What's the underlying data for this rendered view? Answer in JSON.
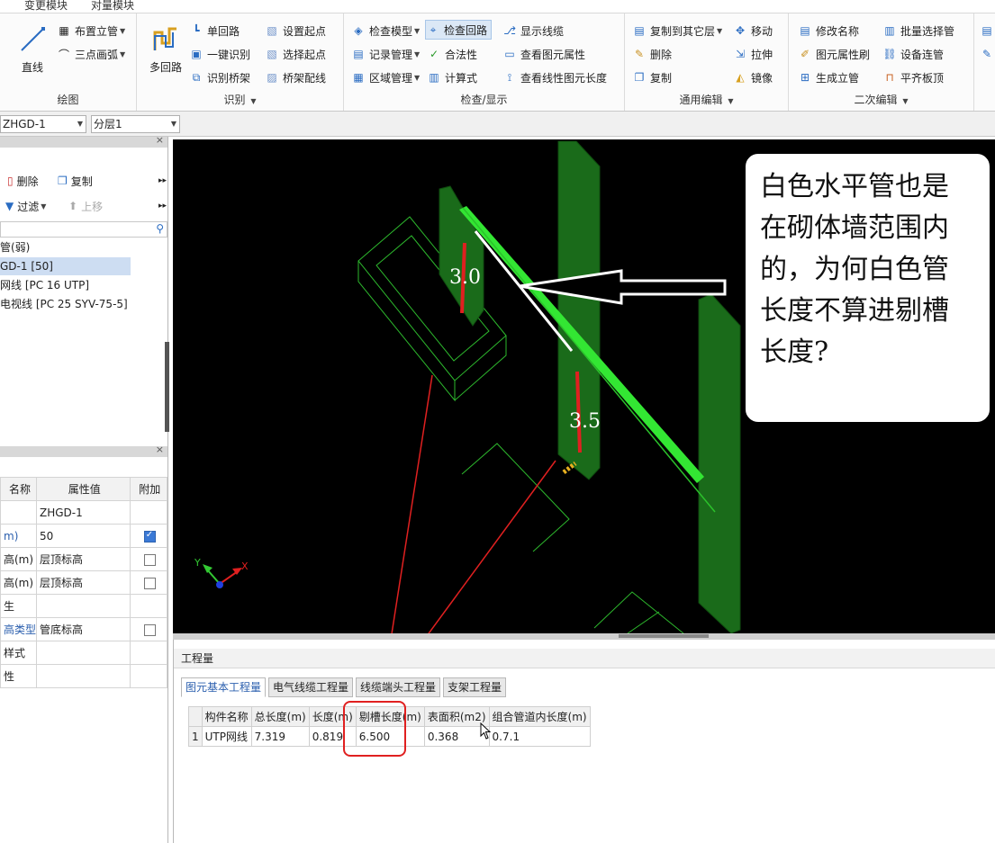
{
  "menubar": {
    "items": [
      "变更模块",
      "对量模块"
    ]
  },
  "ribbon": {
    "groups": [
      {
        "label": "绘图",
        "buttons": [
          "直线",
          "布置立管",
          "三点画弧"
        ]
      },
      {
        "label": "识别",
        "buttons": [
          "多回路",
          "单回路",
          "一键识别",
          "识别桥架",
          "设置起点",
          "选择起点",
          "桥架配线"
        ]
      },
      {
        "label": "检查/显示",
        "buttons": [
          "检查模型",
          "检查回路",
          "显示线缆",
          "记录管理",
          "合法性",
          "查看图元属性",
          "区域管理",
          "计算式",
          "查看线性图元长度"
        ]
      },
      {
        "label": "通用编辑",
        "buttons": [
          "复制到其它层",
          "移动",
          "删除",
          "拉伸",
          "复制",
          "镜像"
        ]
      },
      {
        "label": "二次编辑",
        "buttons": [
          "修改名称",
          "批量选择管",
          "图元属性刷",
          "设备连管",
          "生成立管",
          "平齐板顶"
        ]
      }
    ]
  },
  "selectors": {
    "component": "ZHGD-1",
    "layer": "分层1"
  },
  "nav": {
    "delete": "删除",
    "copy": "复制",
    "filter": "过滤",
    "move_up": "上移",
    "tree": [
      "管(弱)",
      "GD-1 [50]",
      "网线 [PC 16 UTP]",
      "电视线 [PC 25 SYV-75-5]"
    ]
  },
  "props": {
    "headers": [
      "名称",
      "属性值",
      "附加"
    ],
    "rows": [
      {
        "name": "",
        "value": "ZHGD-1",
        "checked": null
      },
      {
        "name": "m)",
        "value": "50",
        "checked": true
      },
      {
        "name": "高(m)",
        "value": "层顶标高",
        "checked": false
      },
      {
        "name": "高(m)",
        "value": "层顶标高",
        "checked": false
      },
      {
        "name": "生",
        "value": "",
        "checked": null
      },
      {
        "name": "高类型",
        "value": "管底标高",
        "checked": false
      },
      {
        "name": "样式",
        "value": "",
        "checked": null
      },
      {
        "name": "性",
        "value": "",
        "checked": null
      }
    ]
  },
  "viewport": {
    "label_a": "3.0",
    "label_b": "3.5",
    "axis_x": "X",
    "axis_y": "Y",
    "callout": "白色水平管也是在砌体墙范围内的，为何白色管长度不算进剔槽长度?"
  },
  "quantities": {
    "title": "工程量",
    "tabs": [
      "图元基本工程量",
      "电气线缆工程量",
      "线缆端头工程量",
      "支架工程量"
    ],
    "columns": [
      "构件名称",
      "总长度(m)",
      "长度(m)",
      "剔槽长度(m)",
      "表面积(m2)",
      "组合管道内长度(m)"
    ],
    "rows": [
      {
        "index": "1",
        "name": "UTP网线",
        "total": "7.319",
        "length": "0.819",
        "groove": "6.500",
        "area": "0.368",
        "inner": "0.7.1"
      }
    ]
  },
  "colors": {
    "wall_green": "#1a6b1a",
    "pipe_green": "#33e633",
    "annotation_red": "#e02020",
    "accent": "#3a79d6"
  }
}
